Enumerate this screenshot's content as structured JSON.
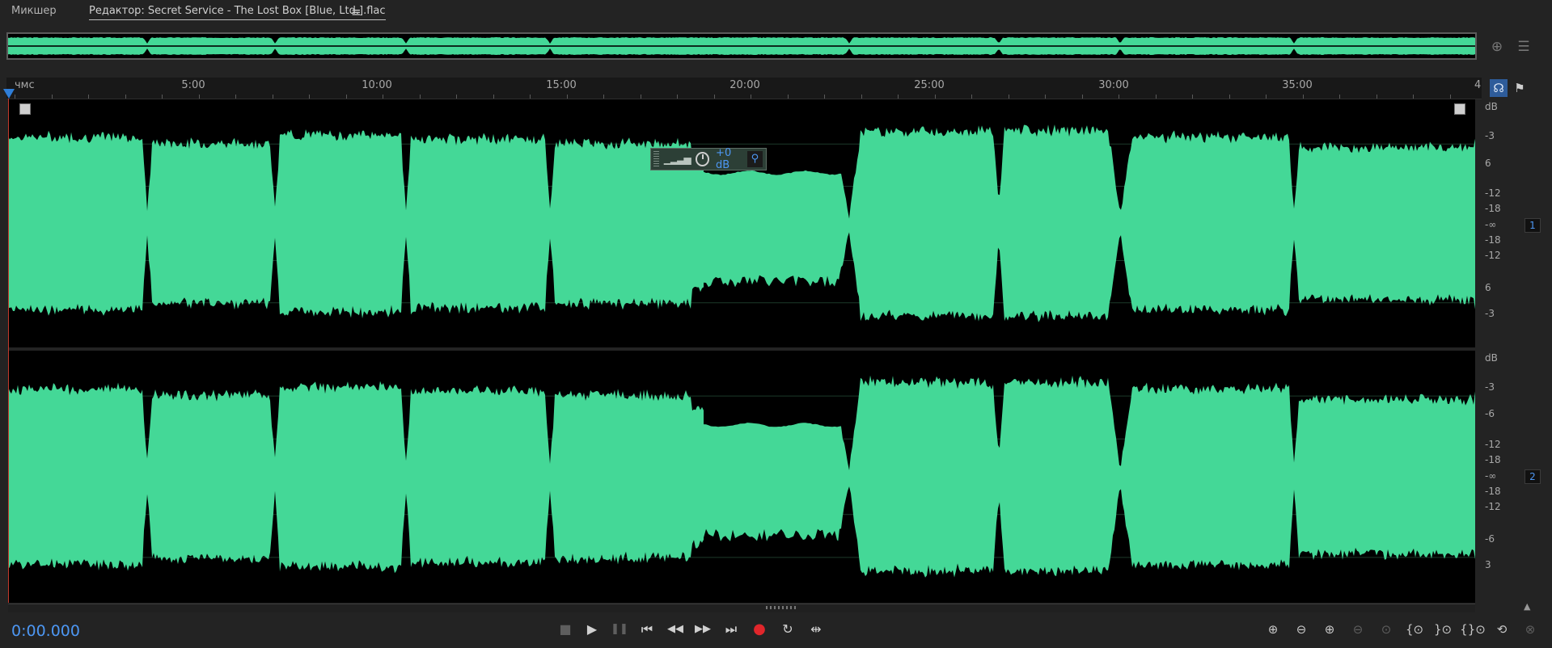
{
  "tabs": {
    "mixer_label": "Микшер",
    "editor_label": "Редактор: Secret Service - The Lost Box [Blue, Ltd.].flac",
    "menu_glyph": "≡"
  },
  "overview": {
    "zoom_icon": "zoom-crosshair-icon",
    "panel_icon": "panel-menu-icon"
  },
  "ruler": {
    "unit_label": "чмс",
    "ticks": [
      "5:00",
      "10:00",
      "15:00",
      "20:00",
      "25:00",
      "30:00",
      "35:00",
      "4"
    ]
  },
  "ruler_icons": {
    "headphones": "headphones-icon",
    "pin": "pin-icon"
  },
  "hud": {
    "value": "+0 dB"
  },
  "db_scale": {
    "ch1": [
      "dB",
      "-3",
      "6",
      "-12",
      "-18",
      "-∞",
      "-18",
      "-12",
      "6",
      "-3"
    ],
    "ch2": [
      "dB",
      "-3",
      "-6",
      "-12",
      "-18",
      "-∞",
      "-18",
      "-12",
      "-6",
      "3"
    ]
  },
  "channels": [
    {
      "number": "1"
    },
    {
      "number": "2"
    }
  ],
  "timecode": "0:00.000",
  "transport": {
    "stop": "■",
    "play": "▶",
    "pause": "❚❚",
    "to_start": "⏮",
    "rewind": "◀◀",
    "fast_forward": "▶▶",
    "to_end": "⏭",
    "record": "●",
    "loop": "↻",
    "skip": "⇹"
  },
  "zoom_tools": [
    {
      "icon": "zoom-in-amplitude-icon",
      "glyph": "⊕",
      "enabled": true
    },
    {
      "icon": "zoom-out-amplitude-icon",
      "glyph": "⊖",
      "enabled": true
    },
    {
      "icon": "zoom-in-time-icon",
      "glyph": "⊕",
      "enabled": true
    },
    {
      "icon": "zoom-out-full-icon",
      "glyph": "⊖",
      "enabled": false
    },
    {
      "icon": "zoom-selection-icon",
      "glyph": "⊙",
      "enabled": false
    },
    {
      "icon": "zoom-in-point-icon",
      "glyph": "{⊙",
      "enabled": true
    },
    {
      "icon": "zoom-out-point-icon",
      "glyph": "}⊙",
      "enabled": true
    },
    {
      "icon": "zoom-selection-range-icon",
      "glyph": "{}⊙",
      "enabled": true
    },
    {
      "icon": "zoom-reset-icon",
      "glyph": "⟲",
      "enabled": true
    },
    {
      "icon": "zoom-extra-icon",
      "glyph": "⊗",
      "enabled": false
    }
  ],
  "colors": {
    "waveform": "#44d897",
    "accent": "#4d97f3",
    "record": "#e0262b",
    "playhead": "#c0392b"
  }
}
